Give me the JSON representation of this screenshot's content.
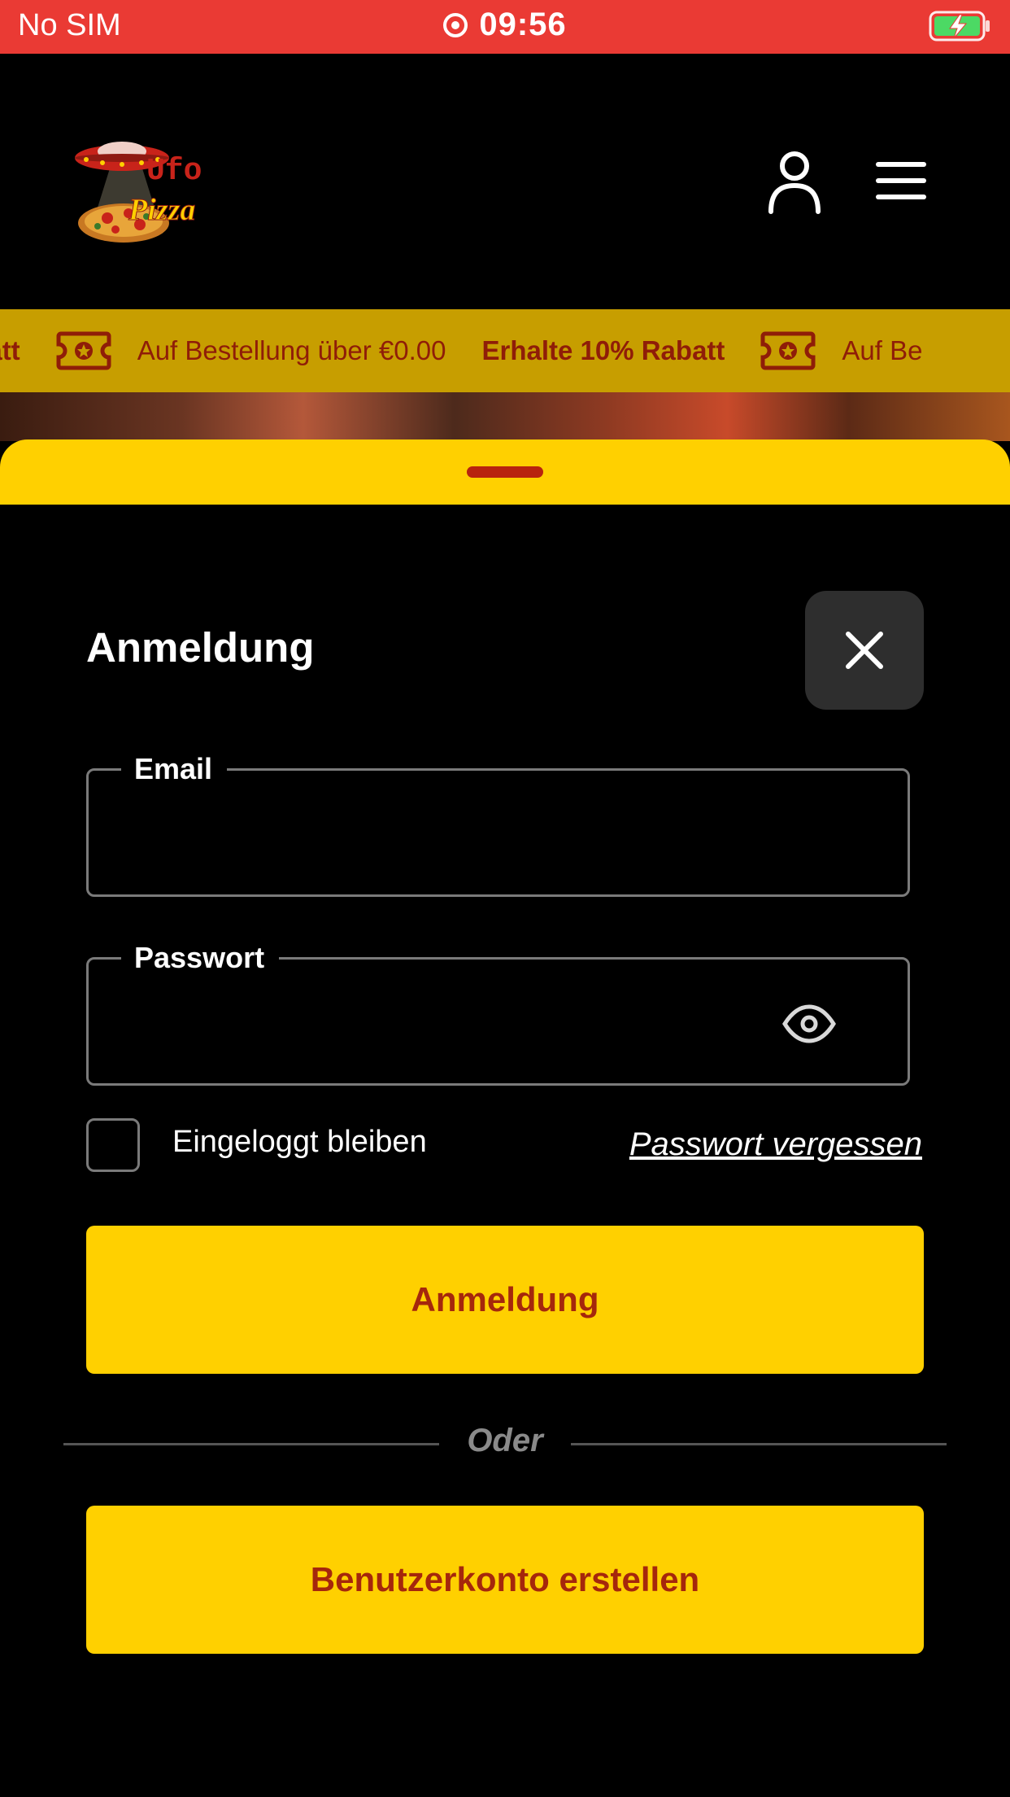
{
  "status_bar": {
    "carrier": "No SIM",
    "time": "09:56"
  },
  "header": {
    "logo_text_top": "Ufo",
    "logo_text_bottom": "Pizza",
    "icons": [
      "user-icon",
      "menu-icon"
    ]
  },
  "promo": {
    "items": [
      {
        "bold": "Rabatt",
        "text": "Auf Bestellung über €0.00"
      },
      {
        "bold": "Erhalte 10% Rabatt",
        "text": "Auf Be"
      }
    ]
  },
  "login": {
    "title": "Anmeldung",
    "email_label": "Email",
    "email_value": "",
    "password_label": "Passwort",
    "password_value": "",
    "remember_label": "Eingeloggt bleiben",
    "remember_checked": false,
    "forgot_link": "Passwort vergessen",
    "login_button": "Anmeldung",
    "divider": "Oder",
    "register_button": "Benutzerkonto erstellen"
  },
  "colors": {
    "status_bar": "#ea3a34",
    "accent_yellow": "#ffd000",
    "promo_bar": "#c79e00",
    "button_text": "#a5270c",
    "background": "#000000"
  }
}
